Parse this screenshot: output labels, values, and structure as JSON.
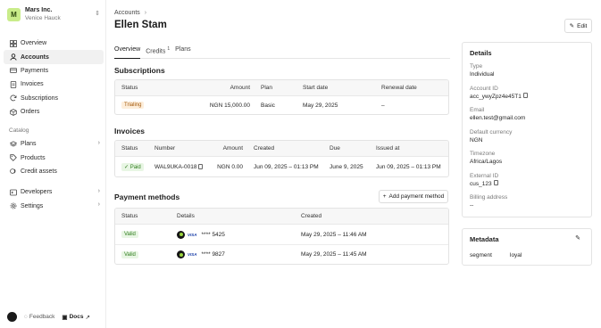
{
  "org": {
    "initial": "M",
    "name": "Mars Inc.",
    "subtitle": "Venice Hauck",
    "switch_glyph": "⇕"
  },
  "nav": {
    "main": [
      {
        "label": "Overview",
        "icon": "grid-icon"
      },
      {
        "label": "Accounts",
        "icon": "user-icon",
        "active": true
      },
      {
        "label": "Payments",
        "icon": "card-icon"
      },
      {
        "label": "Invoices",
        "icon": "document-icon"
      },
      {
        "label": "Subscriptions",
        "icon": "refresh-icon"
      },
      {
        "label": "Orders",
        "icon": "box-icon"
      }
    ],
    "catalog_label": "Catalog",
    "catalog": [
      {
        "label": "Plans",
        "chevron": "›"
      },
      {
        "label": "Products"
      },
      {
        "label": "Credit assets"
      }
    ],
    "bottom": [
      {
        "label": "Developers",
        "chevron": "›"
      },
      {
        "label": "Settings",
        "chevron": "›"
      }
    ]
  },
  "footer": {
    "feedback": "Feedback",
    "docs": "Docs"
  },
  "breadcrumb": {
    "parent": "Accounts",
    "separator": "›"
  },
  "page": {
    "title": "Ellen Stam",
    "edit_label": "Edit"
  },
  "tabs": [
    {
      "label": "Overview",
      "active": true
    },
    {
      "label": "Credits",
      "badge": "1"
    },
    {
      "label": "Plans"
    }
  ],
  "subscriptions": {
    "title": "Subscriptions",
    "headers": [
      "Status",
      "Amount",
      "Plan",
      "Start date",
      "Renewal date"
    ],
    "rows": [
      {
        "status": "Trialing",
        "amount": "NGN 15,000.00",
        "plan": "Basic",
        "start": "May 29, 2025",
        "renewal": "–"
      }
    ]
  },
  "invoices": {
    "title": "Invoices",
    "headers": [
      "Status",
      "Number",
      "Amount",
      "Created",
      "Due",
      "Issued at"
    ],
    "rows": [
      {
        "status": "Paid",
        "number": "WAL9UKA-0018",
        "amount": "NGN 0.00",
        "created": "Jun 09, 2025 – 01:13 PM",
        "due": "June 9, 2025",
        "issued": "Jun 09, 2025 – 01:13 PM"
      }
    ]
  },
  "payment_methods": {
    "title": "Payment methods",
    "add_label": "Add payment method",
    "headers": [
      "Status",
      "Details",
      "Created"
    ],
    "rows": [
      {
        "status": "Valid",
        "brand": "VISA",
        "masked": "**** 5425",
        "created": "May 29, 2025 – 11:46 AM"
      },
      {
        "status": "Valid",
        "brand": "VISA",
        "masked": "**** 9827",
        "created": "May 29, 2025 – 11:45 AM"
      }
    ]
  },
  "details": {
    "title": "Details",
    "fields": [
      {
        "label": "Type",
        "value": "Individual"
      },
      {
        "label": "Account ID",
        "value": "acc_ywyZpz4e45T1",
        "copyable": true
      },
      {
        "label": "Email",
        "value": "ellen.test@gmail.com"
      },
      {
        "label": "Default currency",
        "value": "NGN"
      },
      {
        "label": "Timezone",
        "value": "Africa/Lagos"
      },
      {
        "label": "External ID",
        "value": "cus_123",
        "copyable": true
      },
      {
        "label": "Billing address",
        "value": "--"
      }
    ]
  },
  "metadata": {
    "title": "Metadata",
    "entries": [
      {
        "key": "segment",
        "value": "loyal"
      }
    ]
  },
  "colors": {
    "accent": "#c9ec8a",
    "trialing_bg": "#fdeedb",
    "paid_bg": "#e8f6e4"
  }
}
